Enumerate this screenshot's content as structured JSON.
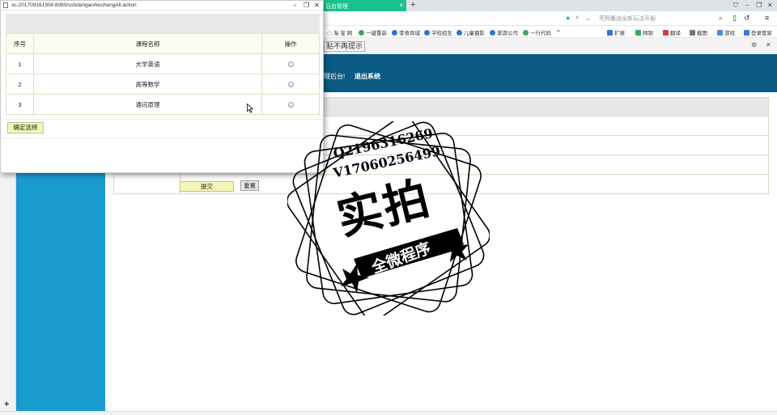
{
  "browser": {
    "active_tab": "后台管理",
    "new_tab_symbol": "+",
    "window_controls": [
      "⛉",
      "−",
      "❐",
      "✕"
    ],
    "search_placeholder": "荒野鏖战全新玩法开服",
    "bookmarks": [
      "淘 宝 网",
      "一键重装",
      "零食商城",
      "学校招生",
      "儿童摄影",
      "旅游公司",
      "一行代码",
      "»"
    ],
    "tools": [
      "扩展",
      "网银",
      "翻译",
      "截图",
      "游戏",
      "登录管家"
    ],
    "notify_text": "贴不再提示",
    "accent_tab_color": "#19c18c"
  },
  "site": {
    "welcome_text": "理后台!",
    "logout_text": "退出系统",
    "header_color": "#0a5a84",
    "sidebar_color": "#1a9bd0",
    "submit_label": "提交",
    "reset_label": "重置",
    "add_symbol": "+"
  },
  "popup": {
    "url": "sc-201709161904:8080/sshdangan/kechengAll.action",
    "table": {
      "headers": [
        "序号",
        "课程名称",
        "操作"
      ],
      "rows": [
        {
          "no": "1",
          "name": "大学英语"
        },
        {
          "no": "2",
          "name": "高等数学"
        },
        {
          "no": "3",
          "name": "通讯原理"
        }
      ]
    },
    "confirm_label": "确定选择"
  },
  "watermark": {
    "line1": "Q2196316269",
    "line2": "V17060256499",
    "big": "实拍",
    "ribbon": "全微程序"
  }
}
